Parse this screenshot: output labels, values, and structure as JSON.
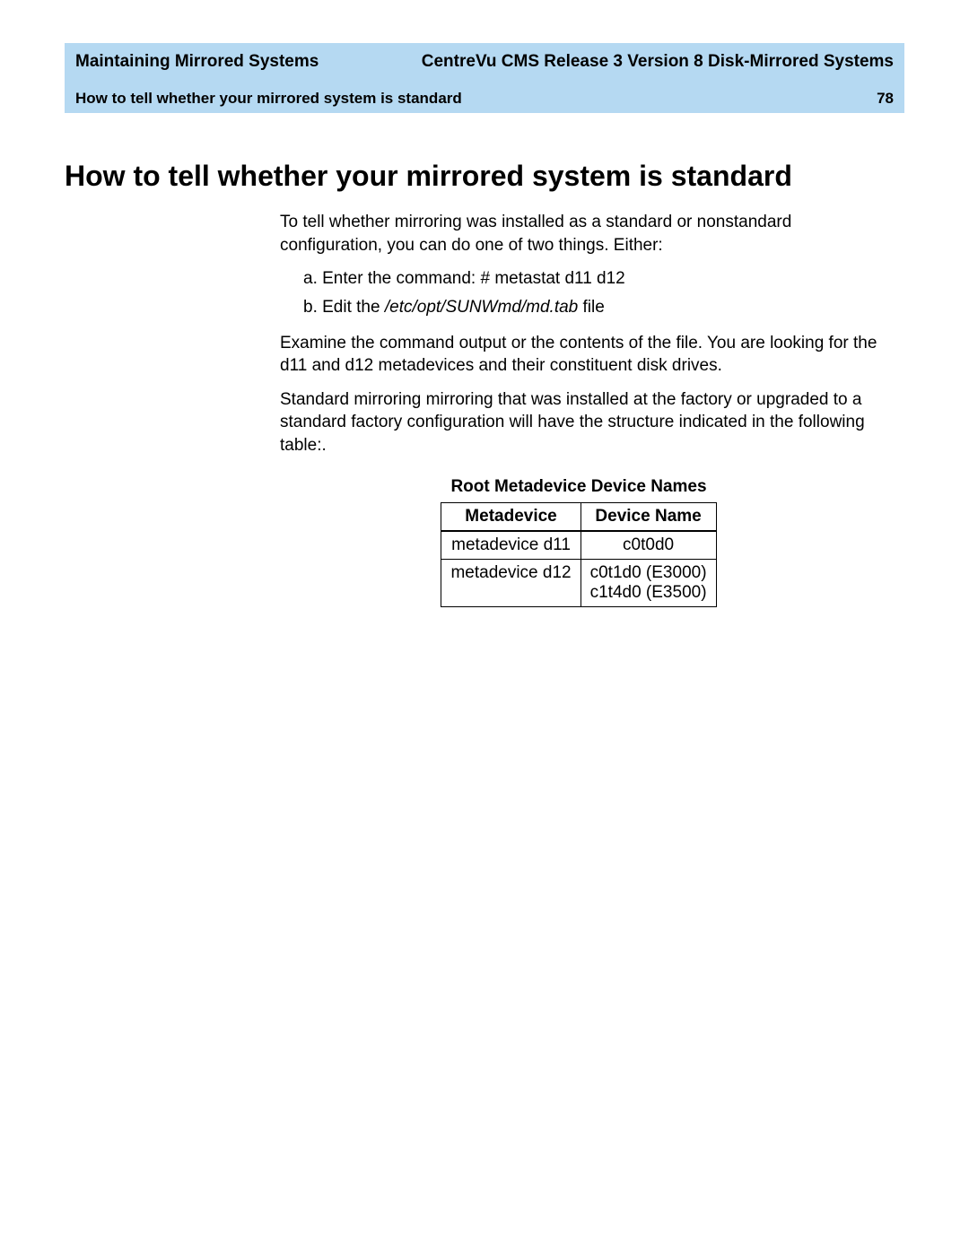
{
  "header": {
    "left": "Maintaining Mirrored Systems",
    "right": "CentreVu CMS Release 3 Version 8 Disk-Mirrored Systems",
    "subleft": "How to tell whether your mirrored system is standard",
    "page": "78"
  },
  "title": "How to tell whether your mirrored system is standard",
  "paragraphs": {
    "intro": "To tell whether mirroring was installed as a  standard  or  nonstandard configuration, you can do one of two things. Either:",
    "listA": "a.  Enter the command:   # metastat d11 d12",
    "listB_prefix": "b.  Edit the ",
    "listB_italic": "/etc/opt/SUNWmd/md.tab",
    "listB_suffix": " file",
    "examine": "Examine the command output or the contents of the file. You are looking for the d11 and d12 metadevices and their constituent disk drives.",
    "standard": "Standard mirroring mirroring that was installed at the factory or upgraded to a standard factory configuration will have the structure indicated in the following table:."
  },
  "table": {
    "title": "Root Metadevice Device Names",
    "headers": [
      "Metadevice",
      "Device Name"
    ],
    "rows": [
      {
        "meta": "metadevice d11",
        "device": "c0t0d0"
      },
      {
        "meta": "metadevice d12",
        "device": "c0t1d0 (E3000)\nc1t4d0 (E3500)"
      }
    ]
  }
}
